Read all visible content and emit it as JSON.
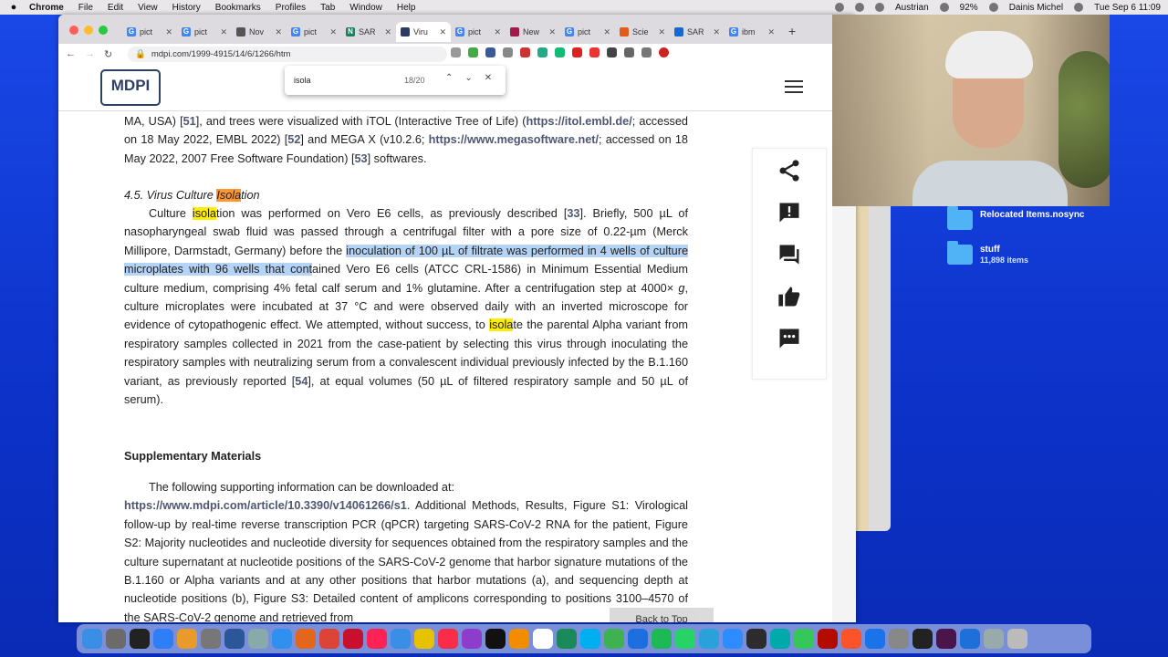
{
  "menubar": {
    "app_name": "Chrome",
    "items": [
      "File",
      "Edit",
      "View",
      "History",
      "Bookmarks",
      "Profiles",
      "Tab",
      "Window",
      "Help"
    ],
    "right": {
      "locale": "Austrian",
      "battery": "92%",
      "user": "Dainis Michel",
      "datetime": "Tue Sep 6  11:09"
    }
  },
  "tabs": [
    {
      "label": "pict",
      "color": "#4285f4",
      "glyph": "G"
    },
    {
      "label": "pict",
      "color": "#4285f4",
      "glyph": "G"
    },
    {
      "label": "Nov",
      "color": "#555555",
      "glyph": ""
    },
    {
      "label": "pict",
      "color": "#4285f4",
      "glyph": "G"
    },
    {
      "label": "SAR",
      "color": "#1a7f5a",
      "glyph": "N"
    },
    {
      "label": "Viru",
      "color": "#2b3a67",
      "glyph": ""
    },
    {
      "label": "pict",
      "color": "#4285f4",
      "glyph": "G"
    },
    {
      "label": "New",
      "color": "#a01a4a",
      "glyph": ""
    },
    {
      "label": "pict",
      "color": "#4285f4",
      "glyph": "G"
    },
    {
      "label": "Scie",
      "color": "#e35a1c",
      "glyph": ""
    },
    {
      "label": "SAR",
      "color": "#1967d2",
      "glyph": ""
    },
    {
      "label": "ibm",
      "color": "#4285f4",
      "glyph": "G"
    }
  ],
  "address": {
    "url": "mdpi.com/1999-4915/14/6/1266/htm"
  },
  "find": {
    "query": "isola",
    "count": "18/20"
  },
  "logo": "MDPI",
  "article": {
    "top_para": {
      "line1a": "MA, USA) [",
      "ref51": "51",
      "line1b": "], and trees were visualized with iTOL (Interactive Tree of Life) (",
      "link_itol": "https://itol.embl.de/",
      "line1c": "; accessed on 18 May 2022, EMBL 2022) [",
      "ref52": "52",
      "line1d": "] and MEGA X (v10.2.6; ",
      "link_mega": "https://www.megasoftware.net/",
      "line1e": "; accessed on 18 May 2022, 2007 Free Software Foundation) [",
      "ref53": "53",
      "line1f": "] softwares."
    },
    "section_heading": {
      "prefix": "4.5. Virus Culture ",
      "hl": "Isola",
      "suffix": "tion"
    },
    "main_para": {
      "t1": "Culture ",
      "hl1": "isola",
      "t2": "tion was performed on Vero E6 cells, as previously described [",
      "ref33": "33",
      "t3": "]. Briefly, 500 µL of nasopharyngeal swab fluid was passed through a centrifugal filter with a pore size of 0.22-µm (Merck Millipore, Darmstadt, Germany) before the ",
      "sel": "inoculation of 100 µL of filtrate was performed in 4 wells of culture microplates with 96 wells that cont",
      "t4": "ained Vero E6 cells (ATCC CRL-1586) in Minimum Essential Medium culture medium, comprising 4% fetal calf serum and 1% glutamine. After a centrifugation step at 4000× ",
      "g": "g",
      "t5": ", culture microplates were incubated at 37 °C and were observed daily with an inverted microscope for evidence of cytopathogenic effect. We attempted, without success, to ",
      "hl2": "isola",
      "t6": "te the parental Alpha variant from respiratory samples collected in 2021 from the case-patient by selecting this virus through inoculating the respiratory samples with neutralizing serum from a convalescent individual previously infected by the B.1.160 variant, as previously reported [",
      "ref54": "54",
      "t7": "], at equal volumes (50 µL of filtered respiratory sample and 50 µL of serum)."
    },
    "supp_heading": "Supplementary Materials",
    "supp_para": {
      "intro": "The following supporting information can be downloaded at:",
      "link": "https://www.mdpi.com/article/10.3390/v14061266/s1",
      "rest": ". Additional Methods, Results, Figure S1: Virological follow-up by real-time reverse transcription PCR (qPCR) targeting SARS-CoV-2 RNA for the patient, Figure S2: Majority nucleotides and nucleotide diversity for sequences obtained from the respiratory samples and the culture supernatant at nucleotide positions of the SARS-CoV-2 genome that harbor signature mutations of the B.1.160 or Alpha variants and at any other positions that harbor mutations (a), and sequencing depth at nucleotide positions (b), Figure S3: Detailed content of amplicons corresponding to positions 3100–4570 of the SARS-CoV-2 genome and retrieved from"
    }
  },
  "back_to_top": "Back to Top",
  "desktop": {
    "folders": [
      {
        "label": "Relocated Items.nosync",
        "sub": ""
      },
      {
        "label": "stuff",
        "sub": "11,898 items"
      }
    ]
  },
  "dock_apps": [
    {
      "name": "finder",
      "color": "#3a8ee6"
    },
    {
      "name": "launchpad",
      "color": "#6b6b6b"
    },
    {
      "name": "terminal",
      "color": "#222"
    },
    {
      "name": "app-store",
      "color": "#2d7ef7"
    },
    {
      "name": "photos",
      "color": "#e89b2a"
    },
    {
      "name": "settings",
      "color": "#777"
    },
    {
      "name": "word",
      "color": "#2b579a"
    },
    {
      "name": "preview",
      "color": "#8aa"
    },
    {
      "name": "safari",
      "color": "#2f90f0"
    },
    {
      "name": "firefox",
      "color": "#e2661c"
    },
    {
      "name": "chrome",
      "color": "#db4437"
    },
    {
      "name": "acrobat",
      "color": "#c8102e"
    },
    {
      "name": "calendar",
      "color": "#f25"
    },
    {
      "name": "mail",
      "color": "#3a8ee6"
    },
    {
      "name": "notes",
      "color": "#e7c200"
    },
    {
      "name": "music",
      "color": "#fa2d48"
    },
    {
      "name": "podcasts",
      "color": "#8e3ccb"
    },
    {
      "name": "tv",
      "color": "#111"
    },
    {
      "name": "books",
      "color": "#f28c00"
    },
    {
      "name": "calendar-6",
      "color": "#fff"
    },
    {
      "name": "vpn",
      "color": "#1b8a5a"
    },
    {
      "name": "skype",
      "color": "#00aff0"
    },
    {
      "name": "maps",
      "color": "#3eb150"
    },
    {
      "name": "xcode",
      "color": "#1d6fe0"
    },
    {
      "name": "spotify",
      "color": "#1db954"
    },
    {
      "name": "whatsapp",
      "color": "#25d366"
    },
    {
      "name": "telegram",
      "color": "#2aa1da"
    },
    {
      "name": "zoom",
      "color": "#2d8cff"
    },
    {
      "name": "activity",
      "color": "#2c2c2c"
    },
    {
      "name": "tv-plus",
      "color": "#0aa"
    },
    {
      "name": "facetime",
      "color": "#35c759"
    },
    {
      "name": "acrobat-2",
      "color": "#b30b00"
    },
    {
      "name": "brave",
      "color": "#fb542b"
    },
    {
      "name": "files",
      "color": "#1a73e8"
    },
    {
      "name": "keychain",
      "color": "#888"
    },
    {
      "name": "notion",
      "color": "#222"
    },
    {
      "name": "slack",
      "color": "#4a154b"
    },
    {
      "name": "quicktime",
      "color": "#1e6fd9"
    },
    {
      "name": "downloads",
      "color": "#9aa"
    },
    {
      "name": "trash",
      "color": "#bbb"
    }
  ]
}
